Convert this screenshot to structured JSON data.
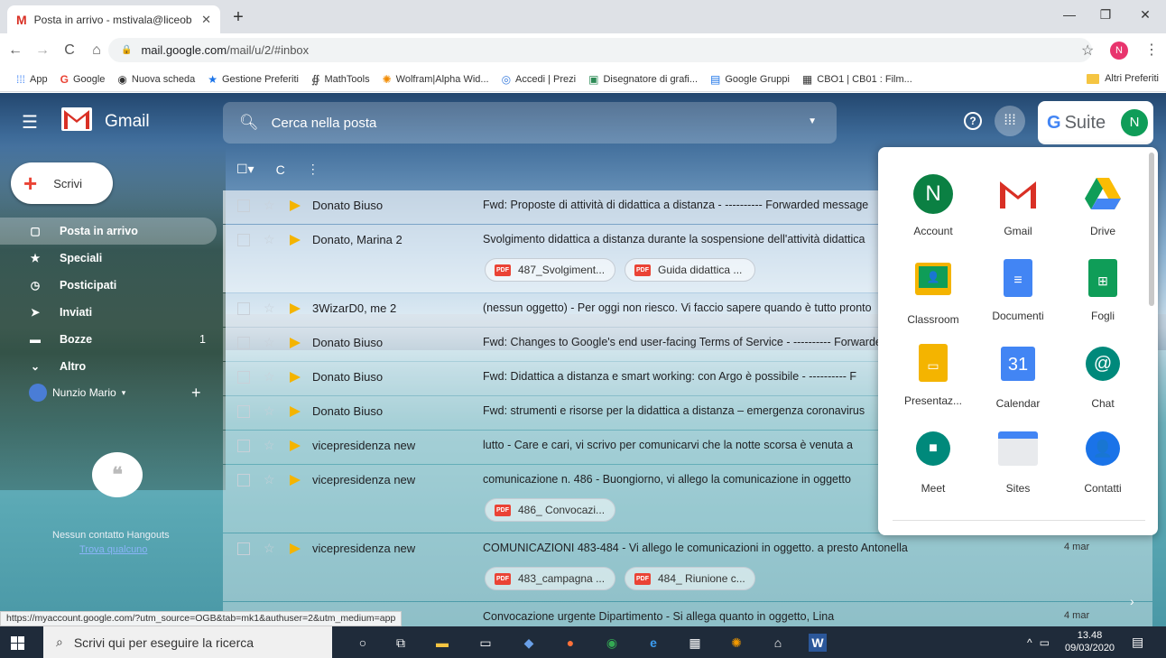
{
  "browser": {
    "tab_title": "Posta in arrivo - mstivala@liceob",
    "url_host": "mail.google.com",
    "url_path": "/mail/u/2/#inbox",
    "profile_initial": "N",
    "bookmarks": [
      {
        "label": "App",
        "icon": "apps-grid-icon"
      },
      {
        "label": "Google",
        "icon": "google-g-icon"
      },
      {
        "label": "Nuova scheda",
        "icon": "globe-icon"
      },
      {
        "label": "Gestione Preferiti",
        "icon": "star-icon"
      },
      {
        "label": "MathTools",
        "icon": "mathtools-icon"
      },
      {
        "label": "Wolfram|Alpha Wid...",
        "icon": "wolfram-icon"
      },
      {
        "label": "Accedi | Prezi",
        "icon": "prezi-icon"
      },
      {
        "label": "Disegnatore di grafi...",
        "icon": "graph-icon"
      },
      {
        "label": "Google Gruppi",
        "icon": "groups-icon"
      },
      {
        "label": "CBO1 | CB01 : Film...",
        "icon": "film-icon"
      }
    ],
    "other_bookmarks": "Altri Preferiti",
    "status_url": "https://myaccount.google.com/?utm_source=OGB&tab=mk1&authuser=2&utm_medium=app"
  },
  "gmail": {
    "brand": "Gmail",
    "search_placeholder": "Cerca nella posta",
    "gsuite_label": "Suite",
    "avatar_initial": "N",
    "compose_label": "Scrivi",
    "nav": [
      {
        "label": "Posta in arrivo",
        "icon": "inbox-icon",
        "count": ""
      },
      {
        "label": "Speciali",
        "icon": "star-icon",
        "count": ""
      },
      {
        "label": "Posticipati",
        "icon": "clock-icon",
        "count": ""
      },
      {
        "label": "Inviati",
        "icon": "send-icon",
        "count": ""
      },
      {
        "label": "Bozze",
        "icon": "draft-icon",
        "count": "1"
      },
      {
        "label": "Altro",
        "icon": "chevron-down-icon",
        "count": ""
      }
    ],
    "user_name": "Nunzio Mario",
    "hangouts_empty": "Nessun contatto Hangouts",
    "hangouts_link": "Trova qualcuno",
    "emails": [
      {
        "sender": "Donato Biuso",
        "subject": "Fwd: Proposte di attività di didattica a distanza - ---------- Forwarded message",
        "date": "",
        "attachments": []
      },
      {
        "sender": "Donato, Marina 2",
        "subject": "Svolgimento didattica a distanza durante la sospensione dell'attività didattica",
        "date": "",
        "attachments": [
          "487_Svolgiment...",
          "Guida didattica ..."
        ]
      },
      {
        "sender": "3WizarD0, me 2",
        "subject": "(nessun oggetto) - Per oggi non riesco. Vi faccio sapere quando è tutto pronto",
        "date": "",
        "attachments": []
      },
      {
        "sender": "Donato Biuso",
        "subject": "Fwd: Changes to Google's end user-facing Terms of Service - ---------- Forwarded",
        "date": "",
        "attachments": []
      },
      {
        "sender": "Donato Biuso",
        "subject": "Fwd: Didattica a distanza e smart working: con Argo è possibile - ---------- F",
        "date": "",
        "attachments": []
      },
      {
        "sender": "Donato Biuso",
        "subject": "Fwd: strumenti e risorse per la didattica a distanza – emergenza coronavirus",
        "date": "",
        "attachments": []
      },
      {
        "sender": "vicepresidenza new",
        "subject": "lutto - Care e cari, vi scrivo per comunicarvi che la notte scorsa è venuta a",
        "date": "",
        "attachments": []
      },
      {
        "sender": "vicepresidenza new",
        "subject": "comunicazione n. 486 - Buongiorno, vi allego la comunicazione in oggetto",
        "date": "",
        "attachments": [
          "486_ Convocazi..."
        ]
      },
      {
        "sender": "vicepresidenza new",
        "subject": "COMUNICAZIONI 483-484 - Vi allego le comunicazioni in oggetto. a presto Antonella",
        "date": "4 mar",
        "attachments": [
          "483_campagna ...",
          "484_ Riunione c..."
        ]
      },
      {
        "sender": "",
        "subject": "Convocazione urgente Dipartimento - Si allega quanto in oggetto, Lina",
        "date": "4 mar",
        "attachments": []
      }
    ],
    "apps": [
      {
        "label": "Account",
        "icon": "account-icon"
      },
      {
        "label": "Gmail",
        "icon": "gmail-icon"
      },
      {
        "label": "Drive",
        "icon": "drive-icon"
      },
      {
        "label": "Classroom",
        "icon": "classroom-icon"
      },
      {
        "label": "Documenti",
        "icon": "docs-icon"
      },
      {
        "label": "Fogli",
        "icon": "sheets-icon"
      },
      {
        "label": "Presentaz...",
        "icon": "slides-icon"
      },
      {
        "label": "Calendar",
        "icon": "calendar-icon"
      },
      {
        "label": "Chat",
        "icon": "chat-icon"
      },
      {
        "label": "Meet",
        "icon": "meet-icon"
      },
      {
        "label": "Sites",
        "icon": "sites-icon"
      },
      {
        "label": "Contatti",
        "icon": "contacts-icon"
      }
    ],
    "calendar_day": "31"
  },
  "taskbar": {
    "search_placeholder": "Scrivi qui per eseguire la ricerca",
    "time": "13.48",
    "date": "09/03/2020"
  }
}
